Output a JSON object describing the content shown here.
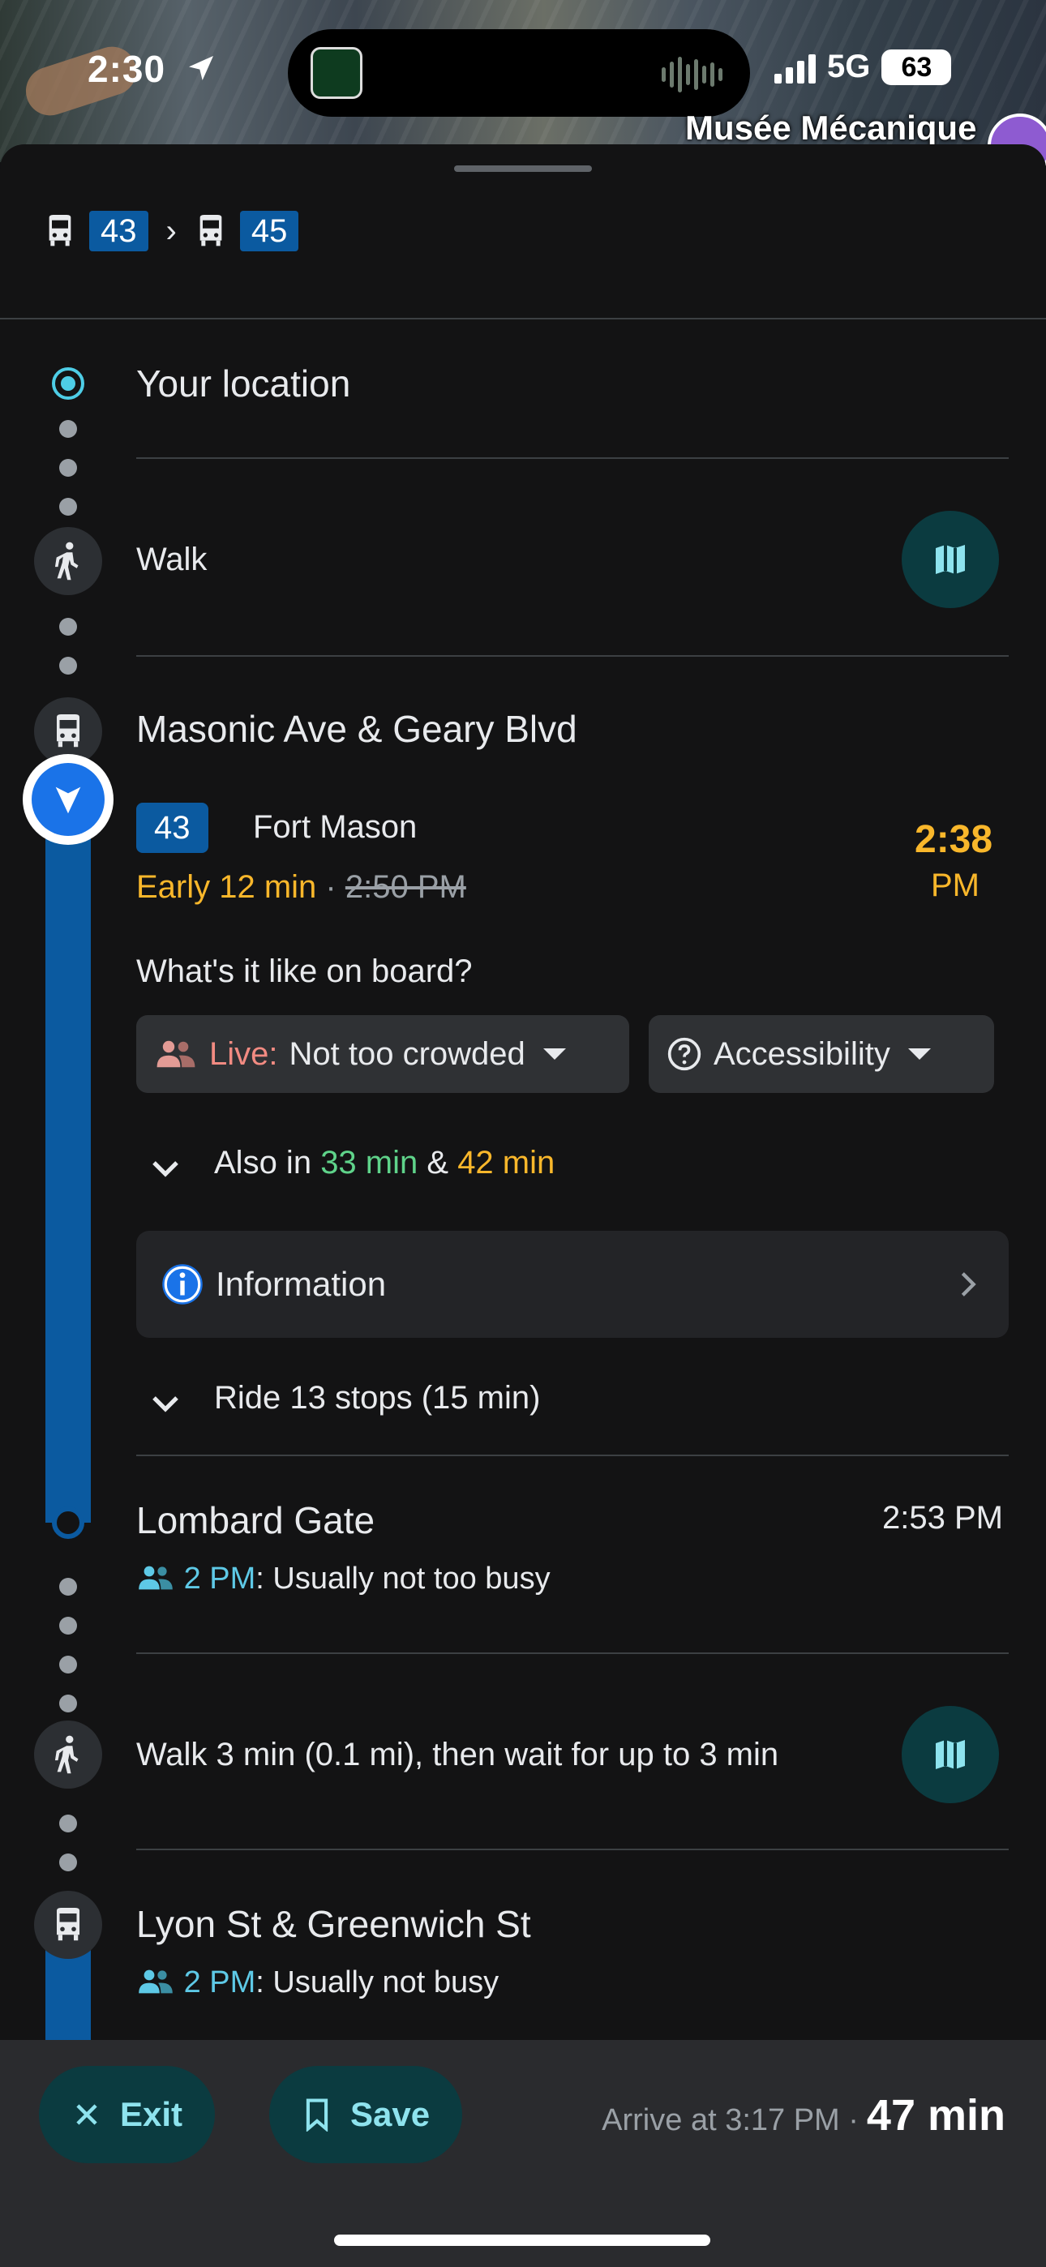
{
  "status_bar": {
    "time": "2:30",
    "network": "5G",
    "battery": "63"
  },
  "map": {
    "label": "Musée Mécanique"
  },
  "colors": {
    "accent": "#4ecde6",
    "route": "#0b5aa0",
    "early": "#f9b72b",
    "on_time": "#5fd38a",
    "info": "#1a73e8"
  },
  "route_summary": {
    "routes": [
      "43",
      "45"
    ],
    "separator": "›"
  },
  "steps": {
    "origin": "Your location",
    "walk1": "Walk",
    "board_stop": "Masonic Ave & Geary Blvd",
    "bus": {
      "route": "43",
      "headsign": "Fort Mason",
      "departure_time": "2:38",
      "departure_ampm": "PM",
      "status": "Early 12 min",
      "status_sep": " · ",
      "scheduled_time": "2:50 PM",
      "onboard_question": "What's it like on board?",
      "crowd_chip_live": "Live:",
      "crowd_chip_value": "Not too crowded",
      "accessibility_chip": "Accessibility",
      "also_in_prefix": "Also in",
      "also_in_1": "33 min",
      "also_in_amp": "&",
      "also_in_2": "42 min",
      "information": "Information",
      "ride": "Ride 13 stops (15 min)"
    },
    "alight_stop": {
      "name": "Lombard Gate",
      "time": "2:53 PM",
      "busy_time": "2 PM",
      "busy_text": ": Usually not too busy"
    },
    "walk2": "Walk 3 min (0.1 mi), then wait for up to 3 min",
    "next_stop": {
      "name": "Lyon St & Greenwich St",
      "busy_time": "2 PM",
      "busy_text": ": Usually not busy"
    }
  },
  "bottom_bar": {
    "exit": "Exit",
    "save": "Save",
    "arrive": "Arrive at 3:17 PM ·",
    "duration": "47 min"
  }
}
